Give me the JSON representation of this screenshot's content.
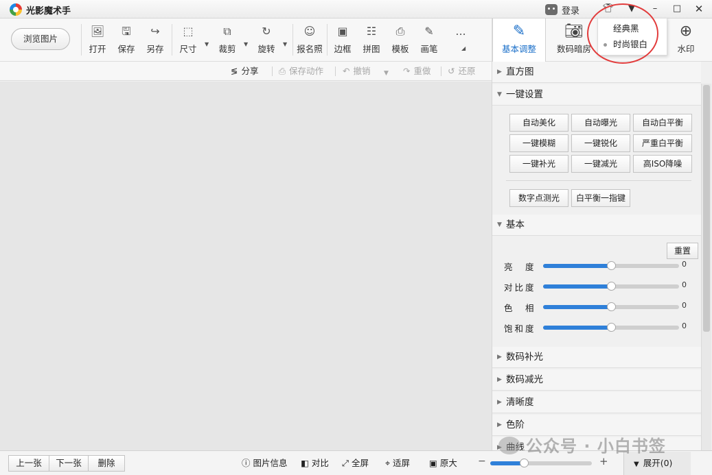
{
  "app": {
    "title": "光影魔术手"
  },
  "titlebar": {
    "login_label": "登录"
  },
  "skin_menu": {
    "items": [
      "经典黑",
      "时尚银白"
    ]
  },
  "toolbar": {
    "browse_label": "浏览图片",
    "tools": [
      {
        "label": "打开",
        "icon": "open-image-icon"
      },
      {
        "label": "保存",
        "icon": "save-icon"
      },
      {
        "label": "另存",
        "icon": "save-as-icon"
      },
      {
        "label": "尺寸",
        "icon": "resize-icon"
      },
      {
        "label": "裁剪",
        "icon": "crop-icon"
      },
      {
        "label": "旋转",
        "icon": "rotate-icon"
      },
      {
        "label": "报名照",
        "icon": "id-photo-icon"
      },
      {
        "label": "边框",
        "icon": "border-icon"
      },
      {
        "label": "拼图",
        "icon": "collage-icon"
      },
      {
        "label": "模板",
        "icon": "template-icon"
      },
      {
        "label": "画笔",
        "icon": "brush-icon"
      }
    ],
    "more_label": "..."
  },
  "actionbar": {
    "share": "分享",
    "save_action": "保存动作",
    "undo": "撤销",
    "redo": "重做",
    "restore": "还原"
  },
  "tabs": [
    {
      "label": "基本调整",
      "active": true
    },
    {
      "label": "数码暗房",
      "active": false
    },
    {
      "label": "水印",
      "active": false
    }
  ],
  "panel": {
    "sections": {
      "histogram": "直方图",
      "one_click": "一键设置",
      "basic": "基本",
      "fill_light": "数码补光",
      "reduce_light": "数码减光",
      "sharpness": "清晰度",
      "levels": "色阶",
      "curves": "曲线"
    },
    "quick_buttons": [
      "自动美化",
      "自动曝光",
      "自动白平衡",
      "一键模糊",
      "一键锐化",
      "严重白平衡",
      "一键补光",
      "一键减光",
      "高ISO降噪"
    ],
    "extra_buttons": [
      "数字点测光",
      "白平衡一指键"
    ],
    "reset_label": "重置",
    "sliders": [
      {
        "label": "亮　度",
        "value": "0",
        "level": 0.5
      },
      {
        "label": "对比度",
        "value": "0",
        "level": 0.5
      },
      {
        "label": "色　相",
        "value": "0",
        "level": 0.5
      },
      {
        "label": "饱和度",
        "value": "0",
        "level": 0.5
      }
    ]
  },
  "statusbar": {
    "prev": "上一张",
    "next": "下一张",
    "delete": "删除",
    "info": "图片信息",
    "compare": "对比",
    "fullscreen": "全屏",
    "fit": "适屏",
    "original": "原大",
    "zoom_level": 0.33,
    "expand": "展开(0)"
  },
  "watermark": {
    "text": "公众号 · 小白书签"
  }
}
